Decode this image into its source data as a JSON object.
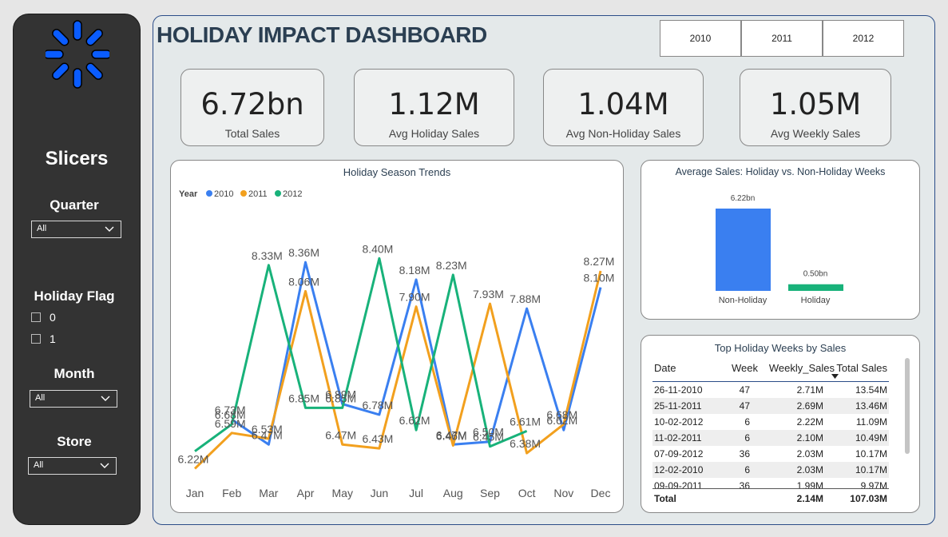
{
  "sidebar": {
    "title": "Slicers",
    "quarter": {
      "label": "Quarter",
      "value": "All"
    },
    "holiday_flag": {
      "label": "Holiday Flag",
      "options": [
        "0",
        "1"
      ]
    },
    "month": {
      "label": "Month",
      "value": "All"
    },
    "store": {
      "label": "Store",
      "value": "All"
    }
  },
  "header": {
    "title": "HOLIDAY IMPACT DASHBOARD",
    "years": [
      "2010",
      "2011",
      "2012"
    ]
  },
  "kpis": [
    {
      "value": "6.72bn",
      "label": "Total Sales"
    },
    {
      "value": "1.12M",
      "label": "Avg Holiday Sales"
    },
    {
      "value": "1.04M",
      "label": "Avg Non-Holiday Sales"
    },
    {
      "value": "1.05M",
      "label": "Avg Weekly Sales"
    }
  ],
  "colors": {
    "y2010": "#3a7ff0",
    "y2011": "#f2a01e",
    "y2012": "#18b27a",
    "accent": "#2b4d88",
    "logo": "#0a5cff"
  },
  "chart_data": [
    {
      "type": "line",
      "title": "Holiday Season Trends",
      "legend_title": "Year",
      "legend_position": "top-left",
      "x": [
        "Jan",
        "Feb",
        "Mar",
        "Apr",
        "May",
        "Jun",
        "Jul",
        "Aug",
        "Sep",
        "Oct",
        "Nov",
        "Dec"
      ],
      "series": [
        {
          "name": "2010",
          "color": "#3a7ff0",
          "values": [
            null,
            6.73,
            6.47,
            8.36,
            6.89,
            6.78,
            8.18,
            6.47,
            6.5,
            7.88,
            6.62,
            8.1
          ],
          "labels": [
            null,
            "6.73M",
            "6.47M",
            "8.36M",
            "6.89M",
            "6.78M",
            "8.18M",
            "6.47M",
            "6.50M",
            "7.88M",
            "6.62M",
            "8.10M"
          ]
        },
        {
          "name": "2011",
          "color": "#f2a01e",
          "values": [
            6.22,
            6.59,
            6.53,
            8.06,
            6.47,
            6.43,
            7.9,
            6.46,
            7.93,
            6.38,
            6.68,
            8.27
          ],
          "labels": [
            "6.22M",
            "6.59M",
            "6.53M",
            "8.06M",
            "6.47M",
            "6.43M",
            "7.90M",
            "6.46M",
            "7.93M",
            "6.38M",
            "6.68M",
            "8.27M"
          ]
        },
        {
          "name": "2012",
          "color": "#18b27a",
          "values": [
            6.4,
            6.68,
            8.33,
            6.85,
            6.85,
            8.4,
            6.62,
            8.23,
            6.45,
            6.61,
            null,
            null
          ],
          "labels": [
            null,
            "6.68M",
            "8.33M",
            "6.85M",
            "6.85M",
            "8.40M",
            "6.62M",
            "8.23M",
            "6.45M",
            "6.61M",
            null,
            null
          ]
        }
      ],
      "ylim": [
        6.0,
        8.9
      ],
      "unit": "M"
    },
    {
      "type": "bar",
      "title": "Average Sales: Holiday vs. Non-Holiday Weeks",
      "categories": [
        "Non-Holiday",
        "Holiday"
      ],
      "values": [
        6.22,
        0.5
      ],
      "labels": [
        "6.22bn",
        "0.50bn"
      ],
      "colors": [
        "#3a7ff0",
        "#18b27a"
      ],
      "unit": "bn"
    }
  ],
  "table": {
    "title": "Top Holiday Weeks by Sales",
    "headers": [
      "Date",
      "Week",
      "Weekly_Sales",
      "Total Sales"
    ],
    "sort_column": "Total Sales",
    "rows": [
      [
        "26-11-2010",
        "47",
        "2.71M",
        "13.54M"
      ],
      [
        "25-11-2011",
        "47",
        "2.69M",
        "13.46M"
      ],
      [
        "10-02-2012",
        "6",
        "2.22M",
        "11.09M"
      ],
      [
        "11-02-2011",
        "6",
        "2.10M",
        "10.49M"
      ],
      [
        "07-09-2012",
        "36",
        "2.03M",
        "10.17M"
      ],
      [
        "12-02-2010",
        "6",
        "2.03M",
        "10.17M"
      ],
      [
        "09-09-2011",
        "36",
        "1.99M",
        "9.97M"
      ]
    ],
    "total": {
      "label": "Total",
      "weekly_sales": "2.14M",
      "total_sales": "107.03M"
    }
  }
}
